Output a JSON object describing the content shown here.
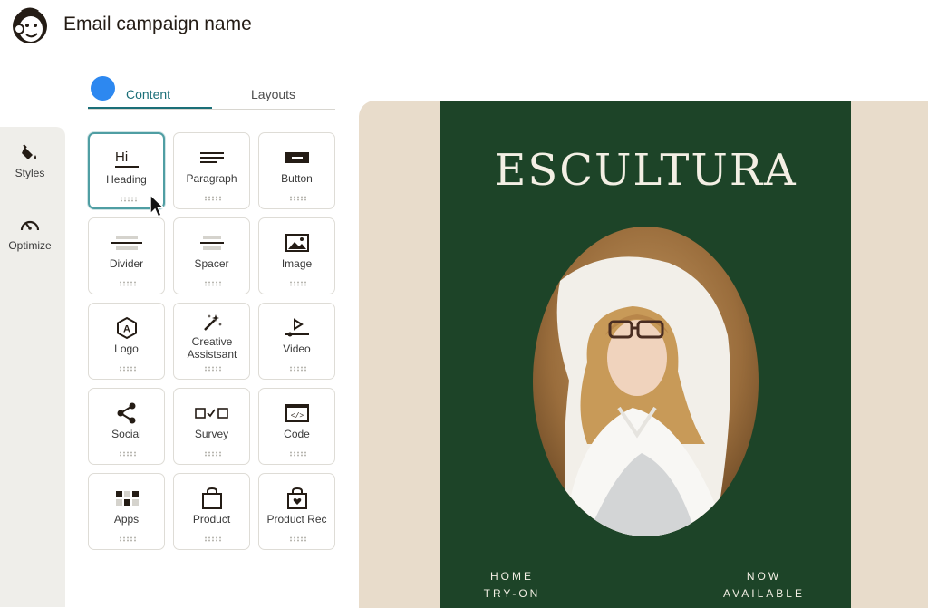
{
  "header": {
    "title": "Email campaign name"
  },
  "rail": {
    "items": [
      {
        "label": "Styles",
        "icon": "paint-bucket-icon"
      },
      {
        "label": "Optimize",
        "icon": "gauge-icon"
      }
    ]
  },
  "tabs": [
    {
      "label": "Content",
      "active": true
    },
    {
      "label": "Layouts",
      "active": false
    }
  ],
  "blocks": [
    {
      "label": "Heading",
      "icon": "heading-icon",
      "icon_text": "Hi",
      "selected": true
    },
    {
      "label": "Paragraph",
      "icon": "paragraph-icon"
    },
    {
      "label": "Button",
      "icon": "button-icon"
    },
    {
      "label": "Divider",
      "icon": "divider-icon"
    },
    {
      "label": "Spacer",
      "icon": "spacer-icon"
    },
    {
      "label": "Image",
      "icon": "image-icon"
    },
    {
      "label": "Logo",
      "icon": "logo-icon",
      "icon_text": "A"
    },
    {
      "label": "Creative Assistsant",
      "icon": "magic-wand-icon"
    },
    {
      "label": "Video",
      "icon": "video-icon"
    },
    {
      "label": "Social",
      "icon": "share-icon"
    },
    {
      "label": "Survey",
      "icon": "survey-icon"
    },
    {
      "label": "Code",
      "icon": "code-icon",
      "icon_text": "</>"
    },
    {
      "label": "Apps",
      "icon": "apps-icon"
    },
    {
      "label": "Product",
      "icon": "shopping-bag-icon"
    },
    {
      "label": "Product Rec",
      "icon": "bag-heart-icon"
    }
  ],
  "preview": {
    "brand": "ESCULTURA",
    "left_text": "HOME TRY-ON",
    "right_text": "NOW AVAILABLE",
    "colors": {
      "poster": "#1d4428",
      "background": "#e8dccb",
      "text": "#f3efe4"
    }
  },
  "colors": {
    "accent": "#1b6f78",
    "tab_dot": "#2d88f0"
  }
}
